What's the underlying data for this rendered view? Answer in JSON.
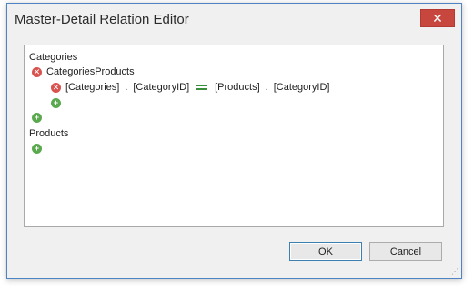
{
  "window": {
    "title": "Master-Detail Relation Editor",
    "close_glyph": "✕"
  },
  "tree": {
    "category_root": "Categories",
    "relation_name": "CategoriesProducts",
    "relation_remove_icon": "remove-icon",
    "condition": {
      "remove_icon": "remove-icon",
      "left_table": "[Categories]",
      "left_separator": ".",
      "left_field": "[CategoryID]",
      "right_table": "[Products]",
      "right_separator": ".",
      "right_field": "[CategoryID]"
    },
    "add_condition_icon": "add-icon",
    "add_relation_icon": "add-icon",
    "product_root": "Products",
    "add_product_relation_icon": "add-icon",
    "remove_glyph": "✕",
    "add_glyph": "+"
  },
  "buttons": {
    "ok_label": "OK",
    "cancel_label": "Cancel"
  },
  "colors": {
    "remove": "#d9534f",
    "add": "#5aa94f",
    "equals": "#3c8f3a",
    "close_button": "#c7473f"
  }
}
